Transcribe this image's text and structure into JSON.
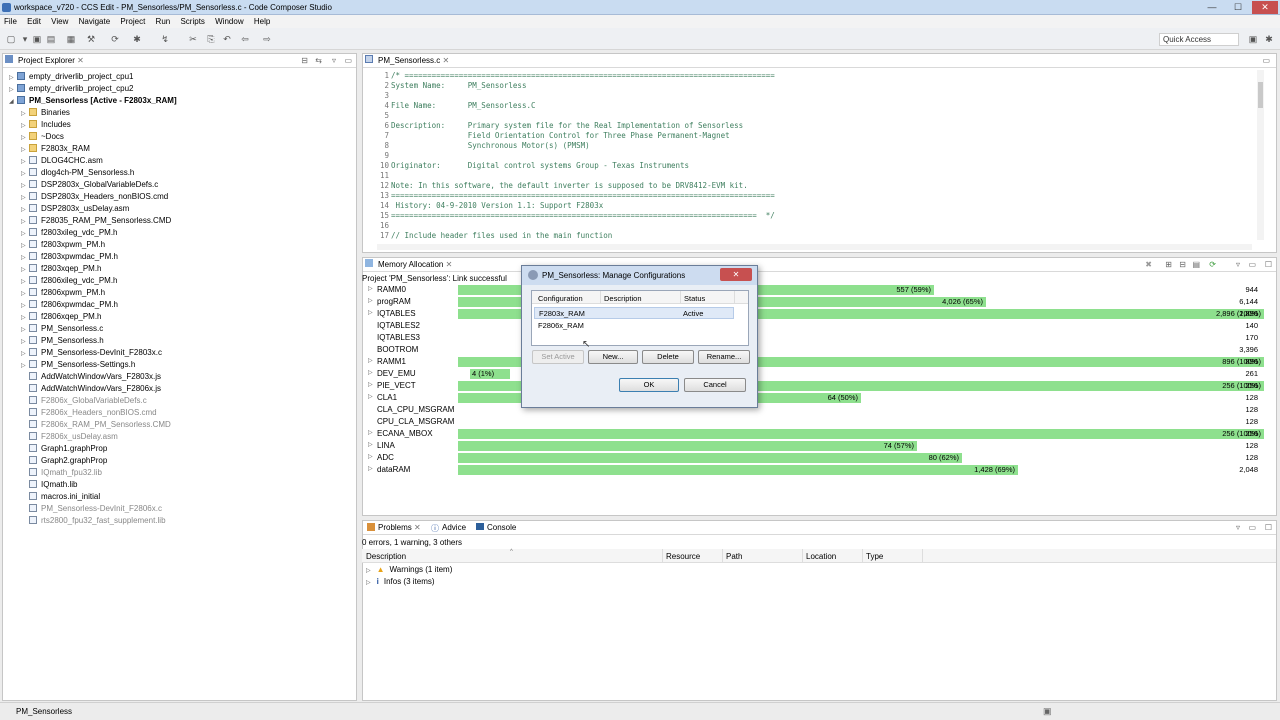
{
  "window": {
    "title": "workspace_v720 - CCS Edit - PM_Sensorless/PM_Sensorless.c - Code Composer Studio",
    "minimize": "—",
    "maximize": "☐",
    "close": "✕"
  },
  "menu": [
    "File",
    "Edit",
    "View",
    "Navigate",
    "Project",
    "Run",
    "Scripts",
    "Window",
    "Help"
  ],
  "toolbar": {
    "quick_access": "Quick Access"
  },
  "explorer": {
    "tab": "Project Explorer",
    "items": [
      {
        "label": "empty_driverlib_project_cpu1",
        "depth": 0,
        "kind": "project",
        "expander": "▷"
      },
      {
        "label": "empty_driverlib_project_cpu2",
        "depth": 0,
        "kind": "project",
        "expander": "▷"
      },
      {
        "label": "PM_Sensorless  [Active - F2803x_RAM]",
        "depth": 0,
        "kind": "project",
        "expander": "◢",
        "bold": true
      },
      {
        "label": "Binaries",
        "depth": 1,
        "kind": "folder",
        "expander": "▷"
      },
      {
        "label": "Includes",
        "depth": 1,
        "kind": "folder",
        "expander": "▷"
      },
      {
        "label": "~Docs",
        "depth": 1,
        "kind": "folder",
        "expander": "▷"
      },
      {
        "label": "F2803x_RAM",
        "depth": 1,
        "kind": "folder",
        "expander": "▷"
      },
      {
        "label": "DLOG4CHC.asm",
        "depth": 1,
        "kind": "file",
        "expander": "▷"
      },
      {
        "label": "dlog4ch-PM_Sensorless.h",
        "depth": 1,
        "kind": "file",
        "expander": "▷"
      },
      {
        "label": "DSP2803x_GlobalVariableDefs.c",
        "depth": 1,
        "kind": "file",
        "expander": "▷"
      },
      {
        "label": "DSP2803x_Headers_nonBIOS.cmd",
        "depth": 1,
        "kind": "file",
        "expander": "▷"
      },
      {
        "label": "DSP2803x_usDelay.asm",
        "depth": 1,
        "kind": "file",
        "expander": "▷"
      },
      {
        "label": "F28035_RAM_PM_Sensorless.CMD",
        "depth": 1,
        "kind": "file",
        "expander": "▷"
      },
      {
        "label": "f2803xileg_vdc_PM.h",
        "depth": 1,
        "kind": "file",
        "expander": "▷"
      },
      {
        "label": "f2803xpwm_PM.h",
        "depth": 1,
        "kind": "file",
        "expander": "▷"
      },
      {
        "label": "f2803xpwmdac_PM.h",
        "depth": 1,
        "kind": "file",
        "expander": "▷"
      },
      {
        "label": "f2803xqep_PM.h",
        "depth": 1,
        "kind": "file",
        "expander": "▷"
      },
      {
        "label": "f2806xileg_vdc_PM.h",
        "depth": 1,
        "kind": "file",
        "expander": "▷"
      },
      {
        "label": "f2806xpwm_PM.h",
        "depth": 1,
        "kind": "file",
        "expander": "▷"
      },
      {
        "label": "f2806xpwmdac_PM.h",
        "depth": 1,
        "kind": "file",
        "expander": "▷"
      },
      {
        "label": "f2806xqep_PM.h",
        "depth": 1,
        "kind": "file",
        "expander": "▷"
      },
      {
        "label": "PM_Sensorless.c",
        "depth": 1,
        "kind": "file",
        "expander": "▷"
      },
      {
        "label": "PM_Sensorless.h",
        "depth": 1,
        "kind": "file",
        "expander": "▷"
      },
      {
        "label": "PM_Sensorless-DevInit_F2803x.c",
        "depth": 1,
        "kind": "file",
        "expander": "▷"
      },
      {
        "label": "PM_Sensorless-Settings.h",
        "depth": 1,
        "kind": "file",
        "expander": "▷"
      },
      {
        "label": "AddWatchWindowVars_F2803x.js",
        "depth": 1,
        "kind": "file",
        "expander": ""
      },
      {
        "label": "AddWatchWindowVars_F2806x.js",
        "depth": 1,
        "kind": "file",
        "expander": ""
      },
      {
        "label": "F2806x_GlobalVariableDefs.c",
        "depth": 1,
        "kind": "file",
        "expander": "",
        "gray": true
      },
      {
        "label": "F2806x_Headers_nonBIOS.cmd",
        "depth": 1,
        "kind": "file",
        "expander": "",
        "gray": true
      },
      {
        "label": "F2806x_RAM_PM_Sensorless.CMD",
        "depth": 1,
        "kind": "file",
        "expander": "",
        "gray": true
      },
      {
        "label": "F2806x_usDelay.asm",
        "depth": 1,
        "kind": "file",
        "expander": "",
        "gray": true
      },
      {
        "label": "Graph1.graphProp",
        "depth": 1,
        "kind": "file",
        "expander": ""
      },
      {
        "label": "Graph2.graphProp",
        "depth": 1,
        "kind": "file",
        "expander": ""
      },
      {
        "label": "IQmath_fpu32.lib",
        "depth": 1,
        "kind": "file",
        "expander": "",
        "gray": true
      },
      {
        "label": "IQmath.lib",
        "depth": 1,
        "kind": "file",
        "expander": ""
      },
      {
        "label": "macros.ini_initial",
        "depth": 1,
        "kind": "file",
        "expander": ""
      },
      {
        "label": "PM_Sensorless-DevInit_F2806x.c",
        "depth": 1,
        "kind": "file",
        "expander": "",
        "gray": true
      },
      {
        "label": "rts2800_fpu32_fast_supplement.lib",
        "depth": 1,
        "kind": "file",
        "expander": "",
        "gray": true
      }
    ]
  },
  "editor": {
    "tab": "PM_Sensorless.c",
    "lines": [
      {
        "n": "1",
        "text": "/* =================================================================================="
      },
      {
        "n": "2",
        "text": "System Name:     PM_Sensorless"
      },
      {
        "n": "3",
        "text": ""
      },
      {
        "n": "4",
        "text": "File Name:       PM_Sensorless.C"
      },
      {
        "n": "5",
        "text": ""
      },
      {
        "n": "6",
        "text": "Description:     Primary system file for the Real Implementation of Sensorless"
      },
      {
        "n": "7",
        "text": "                 Field Orientation Control for Three Phase Permanent-Magnet"
      },
      {
        "n": "8",
        "text": "                 Synchronous Motor(s) (PMSM)"
      },
      {
        "n": "9",
        "text": ""
      },
      {
        "n": "10",
        "text": "Originator:      Digital control systems Group - Texas Instruments"
      },
      {
        "n": "11",
        "text": ""
      },
      {
        "n": "12",
        "text": "Note: In this software, the default inverter is supposed to be DRV8412-EVM kit."
      },
      {
        "n": "13",
        "text": "====================================================================================="
      },
      {
        "n": "14",
        "text": " History: 04-9-2010 Version 1.1: Support F2803x"
      },
      {
        "n": "15",
        "text": "=================================================================================  */"
      },
      {
        "n": "16",
        "text": ""
      },
      {
        "n": "17",
        "text": "// Include header files used in the main function"
      }
    ]
  },
  "memory": {
    "tab": "Memory Allocation",
    "status": "Project 'PM_Sensorless': Link successful",
    "rows": [
      {
        "name": "RAMM0",
        "expander": "▷",
        "label": "557 (59%)",
        "fraction": 0.59,
        "total": "944"
      },
      {
        "name": "progRAM",
        "expander": "▷",
        "label": "4,026 (65%)",
        "fraction": 0.655,
        "total": "6,144"
      },
      {
        "name": "IQTABLES",
        "expander": "▷",
        "label": "2,896 (100%)",
        "fraction": 1.0,
        "total": "2,896"
      },
      {
        "name": "IQTABLES2",
        "expander": "",
        "label": "",
        "fraction": 0,
        "total": "140"
      },
      {
        "name": "IQTABLES3",
        "expander": "",
        "label": "",
        "fraction": 0,
        "total": "170"
      },
      {
        "name": "BOOTROM",
        "expander": "",
        "label": "",
        "fraction": 0,
        "total": "3,396"
      },
      {
        "name": "RAMM1",
        "expander": "▷",
        "label": "896 (100%)",
        "fraction": 1.0,
        "total": "896"
      },
      {
        "name": "DEV_EMU",
        "expander": "▷",
        "label": "4 (1%)",
        "fraction": 0.015,
        "total": "261"
      },
      {
        "name": "PIE_VECT",
        "expander": "▷",
        "label": "256 (100%)",
        "fraction": 1.0,
        "total": "256"
      },
      {
        "name": "CLA1",
        "expander": "▷",
        "label": "64 (50%)",
        "fraction": 0.5,
        "total": "128"
      },
      {
        "name": "CLA_CPU_MSGRAM",
        "expander": "",
        "label": "",
        "fraction": 0,
        "total": "128"
      },
      {
        "name": "CPU_CLA_MSGRAM",
        "expander": "",
        "label": "",
        "fraction": 0,
        "total": "128"
      },
      {
        "name": "ECANA_MBOX",
        "expander": "▷",
        "label": "256 (100%)",
        "fraction": 1.0,
        "total": "256"
      },
      {
        "name": "LINA",
        "expander": "▷",
        "label": "74 (57%)",
        "fraction": 0.57,
        "total": "128"
      },
      {
        "name": "ADC",
        "expander": "▷",
        "label": "80 (62%)",
        "fraction": 0.625,
        "total": "128"
      },
      {
        "name": "dataRAM",
        "expander": "▷",
        "label": "1,428 (69%)",
        "fraction": 0.695,
        "total": "2,048"
      }
    ]
  },
  "problems": {
    "tabs": [
      "Problems",
      "Advice",
      "Console"
    ],
    "summary": "0 errors, 1 warning, 3 others",
    "columns": [
      "Description",
      "Resource",
      "Path",
      "Location",
      "Type"
    ],
    "rows": [
      {
        "icon": "warning-icon",
        "glyph": "▲",
        "color": "#e8a317",
        "label": "Warnings (1 item)"
      },
      {
        "icon": "info-icon",
        "glyph": "i",
        "color": "#1f4e9c",
        "label": "Infos (3 items)"
      }
    ]
  },
  "dialog": {
    "title": "PM_Sensorless: Manage Configurations",
    "close": "✕",
    "columns": [
      "Configuration",
      "Description",
      "Status"
    ],
    "rows": [
      {
        "name": "F2803x_RAM",
        "description": "",
        "status": "Active"
      },
      {
        "name": "F2806x_RAM",
        "description": "",
        "status": ""
      }
    ],
    "buttons": {
      "set_active": "Set Active",
      "new": "New...",
      "delete": "Delete",
      "rename": "Rename...",
      "ok": "OK",
      "cancel": "Cancel"
    }
  },
  "statusbar": {
    "text": "PM_Sensorless"
  },
  "colors": {
    "bar_green": "#8ee08e",
    "accent": "#3b6fb6",
    "selection": "#dfe9f7"
  }
}
